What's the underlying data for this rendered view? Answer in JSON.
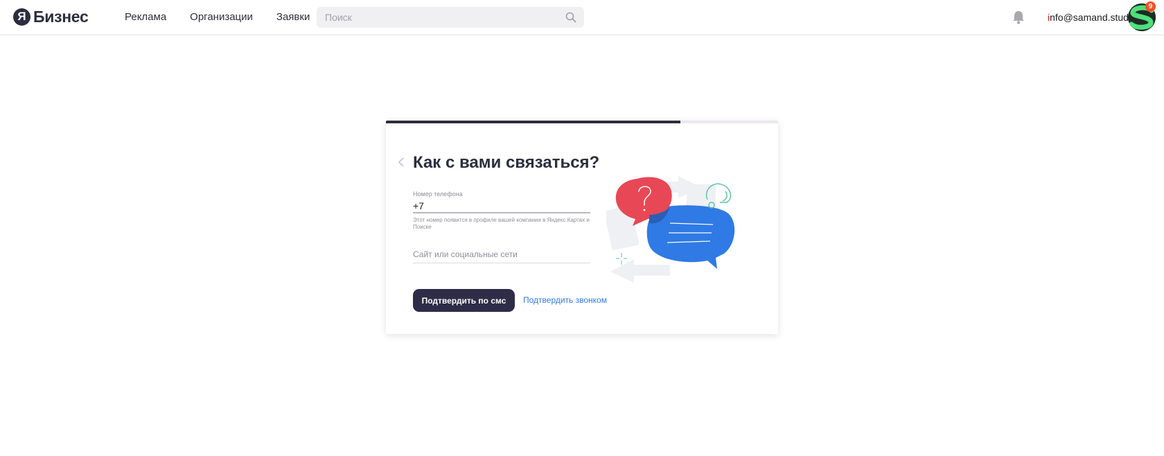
{
  "header": {
    "logo_letter": "Я",
    "logo_text": "Бизнес",
    "nav": [
      {
        "label": "Реклама"
      },
      {
        "label": "Организации"
      },
      {
        "label": "Заявки"
      }
    ],
    "search": {
      "placeholder": "Поиск",
      "value": ""
    },
    "user": {
      "email_first": "i",
      "email_rest": "nfo@samand.studio"
    },
    "notifications_count": "9"
  },
  "card": {
    "progress_fraction": 0.75,
    "title": "Как с вами связаться?",
    "phone": {
      "label": "Номер телефона",
      "value": "+7",
      "hint": "Этот номер появится в профиле вашей компании в Яндекс Картах и Поиске"
    },
    "site": {
      "placeholder": "Сайт или социальные сети",
      "value": ""
    },
    "sms_button_label": "Подтвердить по смс",
    "call_link_label": "Подтвердить звонком"
  },
  "colors": {
    "brand_dark": "#2d2d3f",
    "link_blue": "#2f7ae5",
    "bubble_red": "#e84855",
    "bubble_blue": "#2f7ae5",
    "accent_green": "#56c49a",
    "badge": "#ff4d24"
  },
  "icons": {
    "search": "search-icon",
    "bell": "bell-icon",
    "back": "chevron-left-icon"
  }
}
